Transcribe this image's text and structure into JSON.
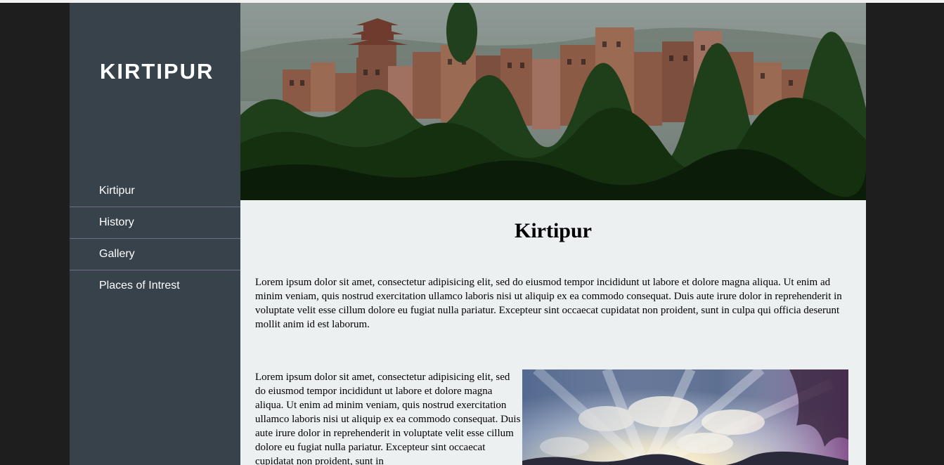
{
  "site": {
    "logo": "KIRTIPUR"
  },
  "nav": {
    "items": [
      {
        "label": "Kirtipur"
      },
      {
        "label": "History"
      },
      {
        "label": "Gallery"
      },
      {
        "label": "Places of Intrest"
      }
    ]
  },
  "article": {
    "title": "Kirtipur",
    "paragraph_1": "Lorem ipsum dolor sit amet, consectetur adipisicing elit, sed do eiusmod tempor incididunt ut labore et dolore magna aliqua. Ut enim ad minim veniam, quis nostrud exercitation ullamco laboris nisi ut aliquip ex ea commodo consequat. Duis aute irure dolor in reprehenderit in voluptate velit esse cillum dolore eu fugiat nulla pariatur. Excepteur sint occaecat cupidatat non proident, sunt in culpa qui officia deserunt mollit anim id est laborum.",
    "paragraph_2": "Lorem ipsum dolor sit amet, consectetur adipisicing elit, sed do eiusmod tempor incididunt ut labore et dolore magna aliqua. Ut enim ad minim veniam, quis nostrud exercitation ullamco laboris nisi ut aliquip ex ea commodo consequat. Duis aute irure dolor in reprehenderit in voluptate velit esse cillum dolore eu fugiat nulla pariatur. Excepteur sint occaecat cupidatat non proident, sunt in"
  },
  "colors": {
    "sidebar_bg": "#38424b",
    "content_bg": "#ecf0f1",
    "nav_divider": "#6f6c87",
    "outer_bg": "#1e1e1e"
  }
}
